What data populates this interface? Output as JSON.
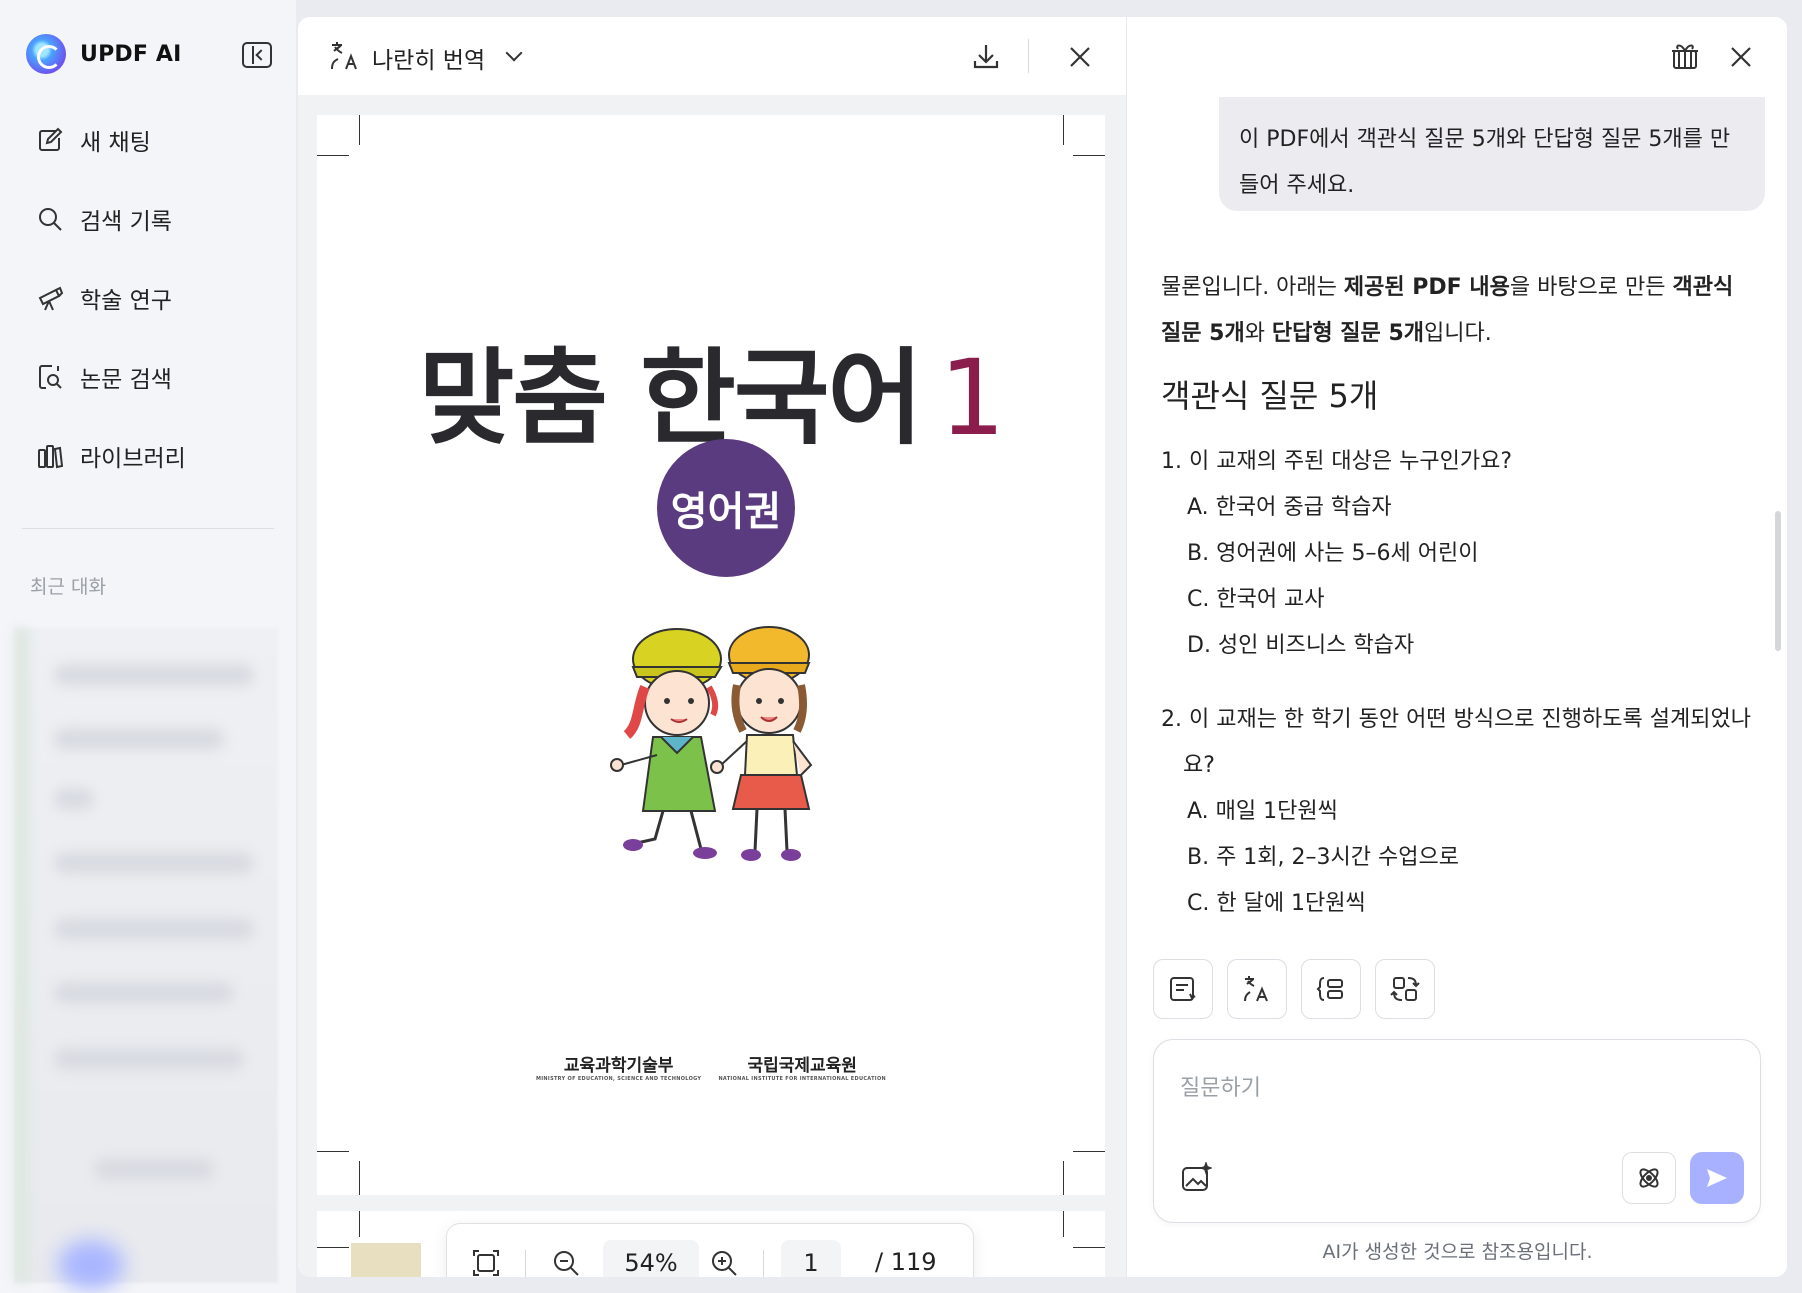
{
  "brand": {
    "name": "UPDF AI"
  },
  "sidebar": {
    "items": [
      {
        "label": "새 채팅",
        "icon": "edit-icon"
      },
      {
        "label": "검색 기록",
        "icon": "search-icon"
      },
      {
        "label": "학술 연구",
        "icon": "telescope-icon"
      },
      {
        "label": "논문 검색",
        "icon": "document-search-icon"
      },
      {
        "label": "라이브러리",
        "icon": "library-icon"
      }
    ],
    "recent_label": "최근 대화"
  },
  "pdf": {
    "mode_label": "나란히 번역",
    "page_title": "맞춤 한국어",
    "page_title_number": "1",
    "badge": "영어권",
    "publisher_left": "교육과학기술부",
    "publisher_left_sub": "MINISTRY OF EDUCATION, SCIENCE AND TECHNOLOGY",
    "publisher_right": "국립국제교육원",
    "publisher_right_sub": "NATIONAL INSTITUTE FOR INTERNATIONAL EDUCATION",
    "zoom": "54%",
    "current_page": "1",
    "total_pages": "/ 119"
  },
  "chat": {
    "user_message": "이 PDF에서 객관식 질문 5개와 단답형 질문 5개를 만들어 주세요.",
    "answer_intro_1": "물론입니다. 아래는 ",
    "answer_intro_b1": "제공된 PDF 내용",
    "answer_intro_2": "을 바탕으로 만든 ",
    "answer_intro_b2": "객관식 질문 5개",
    "answer_intro_3": "와 ",
    "answer_intro_b3": "단답형 질문 5개",
    "answer_intro_4": "입니다.",
    "section_title": "객관식 질문 5개",
    "q1": "1. 이 교재의 주된 대상은 누구인가요?",
    "q1_options": [
      "A. 한국어 중급 학습자",
      "B. 영어권에 사는 5–6세 어린이",
      "C. 한국어 교사",
      "D. 성인 비즈니스 학습자"
    ],
    "q2": "2. 이 교재는 한 학기 동안 어떤 방식으로 진행하도록 설계되었나요?",
    "q2_options": [
      "A. 매일 1단원씩",
      "B. 주 1회, 2–3시간 수업으로",
      "C. 한 달에 1단원씩"
    ],
    "input_placeholder": "질문하기",
    "disclaimer": "AI가 생성한 것으로 참조용입니다."
  },
  "colors": {
    "accent": "#a8b1ff",
    "badge": "#5b3b7f",
    "title_number": "#8b1d4d"
  }
}
